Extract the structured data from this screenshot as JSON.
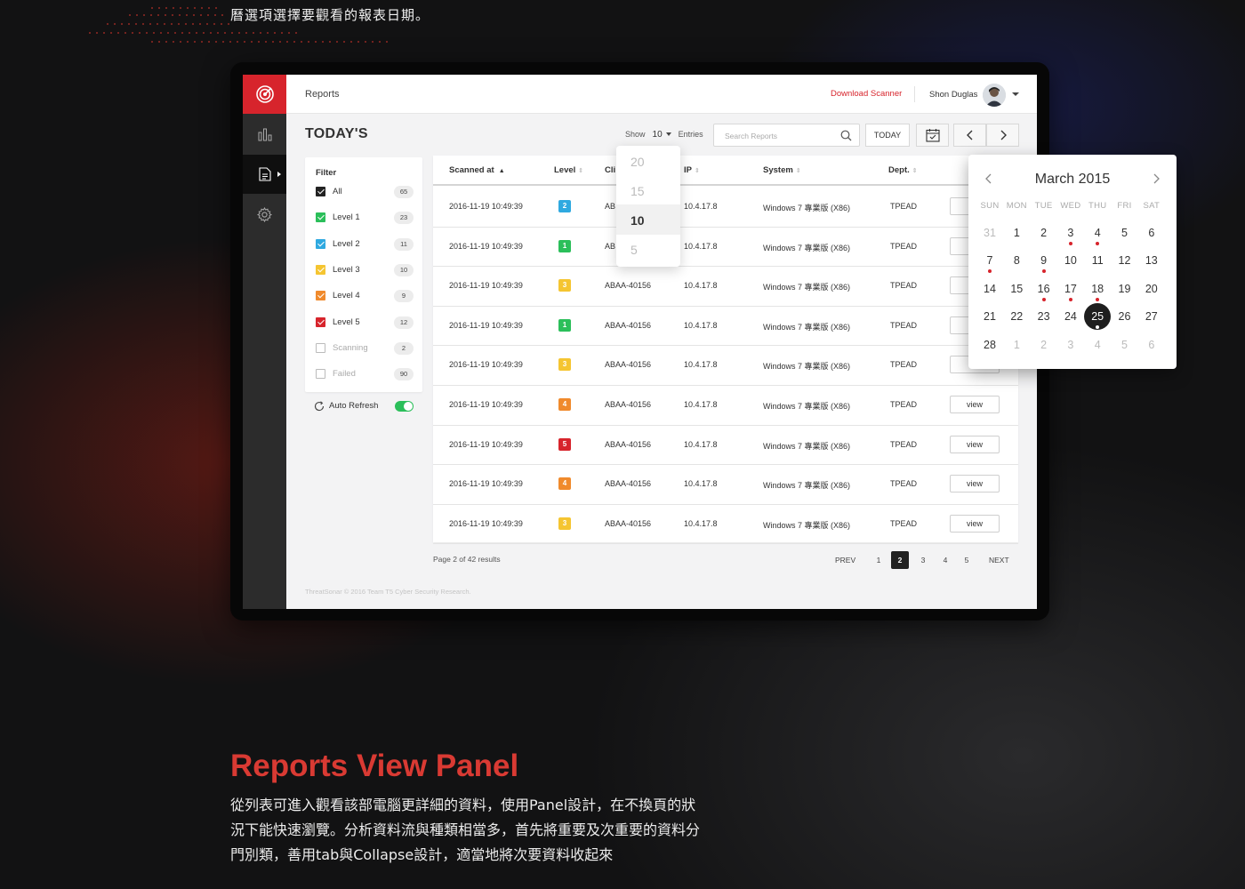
{
  "caption_top": "曆選項選擇要觀看的報表日期。",
  "section": {
    "title": "Reports View Panel",
    "body_lines": [
      "從列表可進入觀看該部電腦更詳細的資料，使用Panel設計，在不換頁的狀",
      "況下能快速瀏覽。分析資料流與種類相當多，首先將重要及次重要的資料分",
      "門別類，善用tab與Collapse設計，適當地將次要資料收起來"
    ]
  },
  "app": {
    "breadcrumb": "Reports",
    "download_label": "Download Scanner",
    "user_name": "Shon Duglas",
    "page_title": "TODAY'S",
    "show_label": "Show",
    "show_value": "10",
    "entries_label": "Entries",
    "search_placeholder": "Search Reports",
    "today_button": "TODAY",
    "footer": "ThreatSonar © 2016 Team T5 Cyber Security Research."
  },
  "nav": {
    "items": [
      "dashboard",
      "reports",
      "settings"
    ],
    "active": "reports"
  },
  "filter": {
    "title": "Filter",
    "items": [
      {
        "label": "All",
        "count": "65",
        "checked": true,
        "color": "#222222"
      },
      {
        "label": "Level 1",
        "count": "23",
        "checked": true,
        "color": "#2bbf5a"
      },
      {
        "label": "Level 2",
        "count": "11",
        "checked": true,
        "color": "#2fa9e0"
      },
      {
        "label": "Level 3",
        "count": "10",
        "checked": true,
        "color": "#f5c531"
      },
      {
        "label": "Level 4",
        "count": "9",
        "checked": true,
        "color": "#f08a2c"
      },
      {
        "label": "Level 5",
        "count": "12",
        "checked": true,
        "color": "#d7242c"
      },
      {
        "label": "Scanning",
        "count": "2",
        "checked": false,
        "color": "#bbbbbb"
      },
      {
        "label": "Failed",
        "count": "90",
        "checked": false,
        "color": "#bbbbbb"
      }
    ],
    "auto_refresh_label": "Auto Refresh",
    "auto_refresh_on": true
  },
  "table": {
    "columns": [
      "Scanned at",
      "Level",
      "Cli",
      "IP",
      "System",
      "Dept."
    ],
    "rows": [
      {
        "scanned": "2016-11-19 10:49:39",
        "level": "2",
        "client": "AB",
        "ip": "10.4.17.8",
        "system": "Windows 7 專業版 (X86)",
        "dept": "TPEAD",
        "action": "v"
      },
      {
        "scanned": "2016-11-19 10:49:39",
        "level": "1",
        "client": "AB",
        "ip": "10.4.17.8",
        "system": "Windows 7 專業版 (X86)",
        "dept": "TPEAD",
        "action": "v"
      },
      {
        "scanned": "2016-11-19 10:49:39",
        "level": "3",
        "client": "ABAA-40156",
        "ip": "10.4.17.8",
        "system": "Windows 7 專業版 (X86)",
        "dept": "TPEAD",
        "action": "v"
      },
      {
        "scanned": "2016-11-19 10:49:39",
        "level": "1",
        "client": "ABAA-40156",
        "ip": "10.4.17.8",
        "system": "Windows 7 專業版 (X86)",
        "dept": "TPEAD",
        "action": "v"
      },
      {
        "scanned": "2016-11-19 10:49:39",
        "level": "3",
        "client": "ABAA-40156",
        "ip": "10.4.17.8",
        "system": "Windows 7 專業版 (X86)",
        "dept": "TPEAD",
        "action": "v"
      },
      {
        "scanned": "2016-11-19 10:49:39",
        "level": "4",
        "client": "ABAA-40156",
        "ip": "10.4.17.8",
        "system": "Windows 7 專業版 (X86)",
        "dept": "TPEAD",
        "action": "view"
      },
      {
        "scanned": "2016-11-19 10:49:39",
        "level": "5",
        "client": "ABAA-40156",
        "ip": "10.4.17.8",
        "system": "Windows 7 專業版 (X86)",
        "dept": "TPEAD",
        "action": "view"
      },
      {
        "scanned": "2016-11-19 10:49:39",
        "level": "4",
        "client": "ABAA-40156",
        "ip": "10.4.17.8",
        "system": "Windows 7 專業版 (X86)",
        "dept": "TPEAD",
        "action": "view"
      },
      {
        "scanned": "2016-11-19 10:49:39",
        "level": "3",
        "client": "ABAA-40156",
        "ip": "10.4.17.8",
        "system": "Windows 7 專業版 (X86)",
        "dept": "TPEAD",
        "action": "view"
      }
    ],
    "level_colors": {
      "1": "#2bbf5a",
      "2": "#2fa9e0",
      "3": "#f5c531",
      "4": "#f08a2c",
      "5": "#d7242c"
    }
  },
  "pagination": {
    "info": "Page 2 of 42 results",
    "prev": "PREV",
    "pages": [
      "1",
      "2",
      "3",
      "4",
      "5"
    ],
    "current": "2",
    "next": "NEXT"
  },
  "entries_dropdown": {
    "options": [
      "20",
      "15",
      "10",
      "5"
    ],
    "selected": "10"
  },
  "calendar": {
    "title": "March 2015",
    "weekdays": [
      "SUN",
      "MON",
      "TUE",
      "WED",
      "THU",
      "FRI",
      "SAT"
    ],
    "weeks": [
      [
        "31",
        "1",
        "2",
        "3",
        "4",
        "5",
        "6"
      ],
      [
        "7",
        "8",
        "9",
        "10",
        "11",
        "12",
        "13"
      ],
      [
        "14",
        "15",
        "16",
        "17",
        "18",
        "19",
        "20"
      ],
      [
        "21",
        "22",
        "23",
        "24",
        "25",
        "26",
        "27"
      ],
      [
        "28",
        "1",
        "2",
        "3",
        "4",
        "5",
        "6"
      ]
    ],
    "outside_days": [
      [
        0,
        0
      ],
      [
        4,
        1
      ],
      [
        4,
        2
      ],
      [
        4,
        3
      ],
      [
        4,
        4
      ],
      [
        4,
        5
      ],
      [
        4,
        6
      ]
    ],
    "selected_day": "25",
    "event_days": [
      "3",
      "4",
      "7",
      "9",
      "16",
      "17",
      "18",
      "25"
    ]
  },
  "colors": {
    "brand_red": "#d7242c",
    "nav_dark": "#2c2c2c",
    "toggle_green": "#2bbf5a"
  }
}
